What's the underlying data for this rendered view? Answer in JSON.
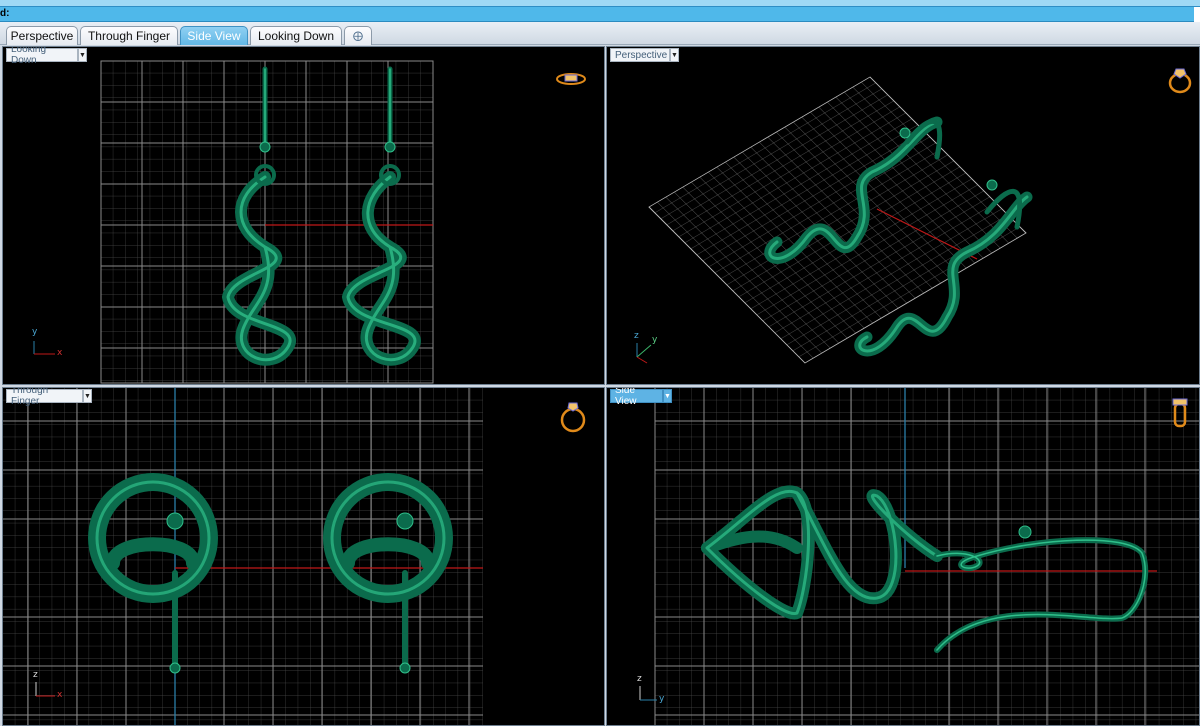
{
  "command_bar": {
    "label": "d:"
  },
  "tabs": [
    {
      "label": "Perspective",
      "active": false
    },
    {
      "label": "Through Finger",
      "active": false
    },
    {
      "label": "Side View",
      "active": true
    },
    {
      "label": "Looking Down",
      "active": false
    }
  ],
  "add_tab_icon": "plus-icon",
  "viewports": {
    "looking_down": {
      "label": "Looking Down",
      "active": false,
      "axes": {
        "vertical": "y",
        "horizontal": "x"
      },
      "nav_icon": "ring-top-icon"
    },
    "perspective": {
      "label": "Perspective",
      "active": false,
      "axes": {
        "vertical": "z",
        "horizontal": "y"
      },
      "nav_icon": "ring-perspective-icon"
    },
    "through_finger": {
      "label": "Through Finger",
      "active": false,
      "axes": {
        "vertical": "z",
        "horizontal": "x"
      },
      "nav_icon": "ring-front-icon"
    },
    "side_view": {
      "label": "Side View",
      "active": true,
      "axes": {
        "vertical": "z",
        "horizontal": "y"
      },
      "nav_icon": "ring-side-icon"
    }
  },
  "colors": {
    "model": "#0b6b4c",
    "model_highlight": "#2fbf8a",
    "grid": "#5a5a5a",
    "grid_major": "#888888",
    "x_axis": "#c01818",
    "y_axis": "#2a7fa8",
    "active_blue": "#5eb3e4"
  }
}
